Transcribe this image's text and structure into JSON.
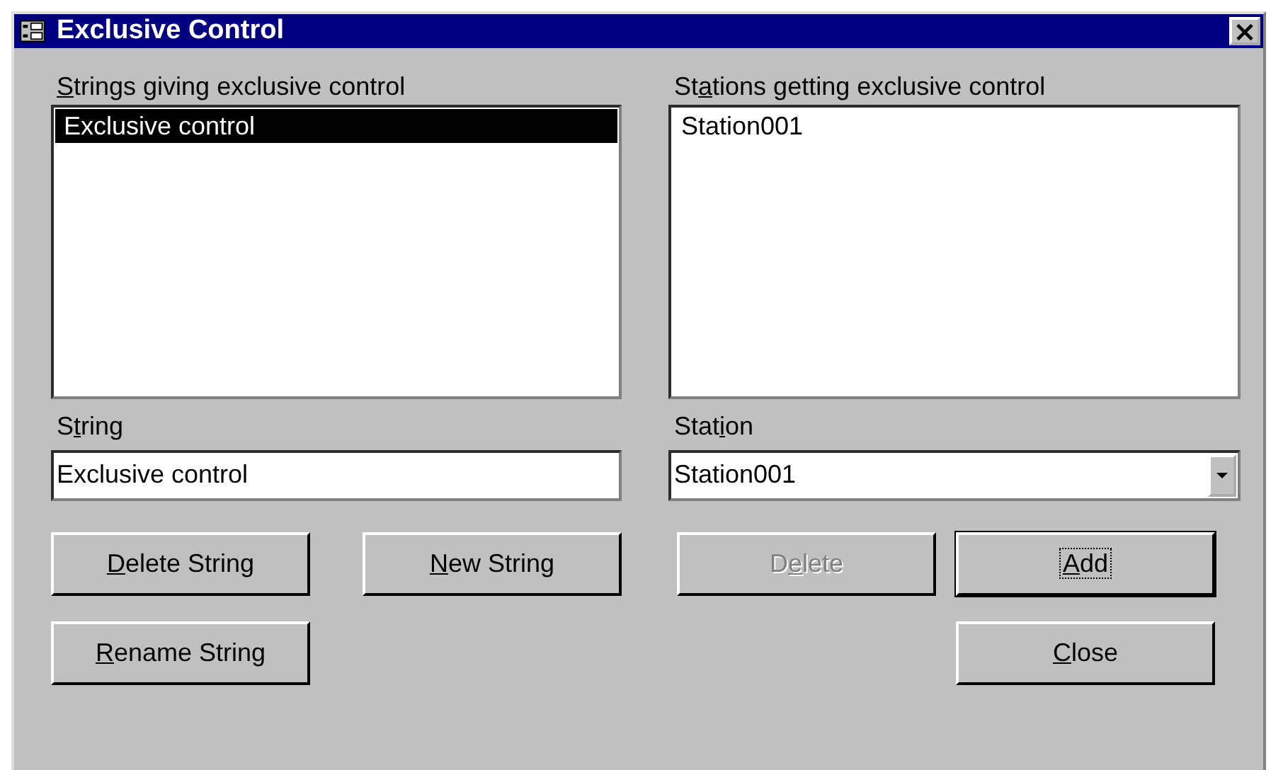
{
  "window": {
    "title": "Exclusive Control",
    "close": "×"
  },
  "strings_list": {
    "label": {
      "key": "S",
      "post": "trings giving exclusive control"
    },
    "items": [
      {
        "text": "Exclusive control",
        "selected": true
      }
    ]
  },
  "stations_list": {
    "label": {
      "pre": "St",
      "key": "a",
      "post": "tions getting exclusive control"
    },
    "items": [
      {
        "text": "Station001",
        "selected": false
      }
    ]
  },
  "string_field": {
    "label": {
      "pre": "S",
      "key": "t",
      "post": "ring"
    },
    "value": "Exclusive control"
  },
  "station_combo": {
    "label": {
      "pre": "Stat",
      "key": "i",
      "post": "on"
    },
    "value": "Station001"
  },
  "buttons": [
    {
      "label": {
        "key": "D",
        "post": "elete String"
      },
      "disabled": false,
      "default": false,
      "focused": false
    },
    {
      "label": {
        "key": "N",
        "post": "ew String"
      },
      "disabled": false,
      "default": false,
      "focused": false
    },
    {
      "label": {
        "pre": "D",
        "key": "e",
        "post": "lete"
      },
      "disabled": true,
      "default": false,
      "focused": false
    },
    {
      "label": {
        "key": "A",
        "post": "dd"
      },
      "disabled": false,
      "default": true,
      "focused": true
    },
    {
      "label": {
        "key": "R",
        "post": "ename String"
      },
      "disabled": false,
      "default": false,
      "focused": false
    },
    {
      "label": {
        "key": "C",
        "post": "lose"
      },
      "disabled": false,
      "default": false,
      "focused": false
    }
  ]
}
